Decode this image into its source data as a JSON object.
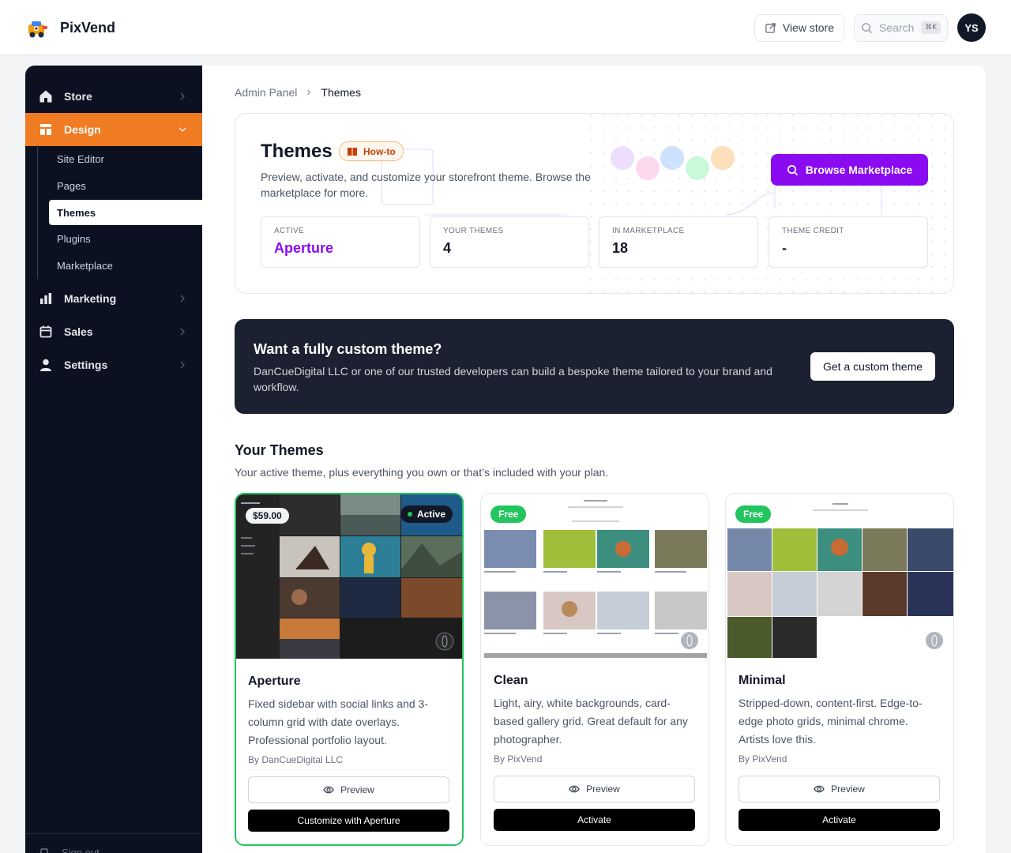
{
  "brand": {
    "name": "PixVend"
  },
  "topbar": {
    "view_store_label": "View store",
    "search_placeholder": "Search",
    "search_shortcut": "⌘K",
    "avatar_initials": "YS"
  },
  "sidebar": {
    "items": [
      {
        "label": "Store",
        "icon": "home-icon"
      },
      {
        "label": "Design",
        "icon": "layout-icon",
        "active": true
      },
      {
        "label": "Marketing",
        "icon": "bar-chart-icon"
      },
      {
        "label": "Sales",
        "icon": "calendar-icon"
      },
      {
        "label": "Settings",
        "icon": "user-icon"
      }
    ],
    "design_subitems": [
      "Site Editor",
      "Pages",
      "Themes",
      "Plugins",
      "Marketplace"
    ],
    "active_subitem": "Themes",
    "signout_label": "Sign out"
  },
  "breadcrumb": {
    "parent": "Admin Panel",
    "current": "Themes"
  },
  "hero": {
    "title": "Themes",
    "howto_label": "How-to",
    "description": "Preview, activate, and customize your storefront theme. Browse the marketplace for more.",
    "browse_label": "Browse Marketplace",
    "stats": [
      {
        "label": "ACTIVE",
        "value": "Aperture"
      },
      {
        "label": "YOUR THEMES",
        "value": "4"
      },
      {
        "label": "IN MARKETPLACE",
        "value": "18"
      },
      {
        "label": "THEME CREDIT",
        "value": "-"
      }
    ]
  },
  "promo": {
    "title": "Want a fully custom theme?",
    "text": "DanCueDigital LLC or one of our trusted developers can build a bespoke theme tailored to your brand and workflow.",
    "button_label": "Get a custom theme"
  },
  "your_themes": {
    "title": "Your Themes",
    "description": "Your active theme, plus everything you own or that’s included with your plan.",
    "cards": [
      {
        "name": "Aperture",
        "price_badge": "$59.00",
        "status_badge": "Active",
        "description": "Fixed sidebar with social links and 3-column grid with date overlays. Professional portfolio layout.",
        "author": "By DanCueDigital LLC",
        "preview_label": "Preview",
        "cta_label": "Customize with Aperture"
      },
      {
        "name": "Clean",
        "price_badge": "Free",
        "description": "Light, airy, white backgrounds, card-based gallery grid. Great default for any photographer.",
        "author": "By PixVend",
        "preview_label": "Preview",
        "cta_label": "Activate"
      },
      {
        "name": "Minimal",
        "price_badge": "Free",
        "description": "Stripped-down, content-first. Edge-to-edge photo grids, minimal chrome. Artists love this.",
        "author": "By PixVend",
        "preview_label": "Preview",
        "cta_label": "Activate"
      }
    ]
  },
  "colors": {
    "accent_orange": "#ef7b22",
    "accent_purple": "#8a0bf0",
    "active_green": "#22c55e",
    "sidebar_bg": "#0b1120",
    "promo_bg": "#1b2130"
  }
}
